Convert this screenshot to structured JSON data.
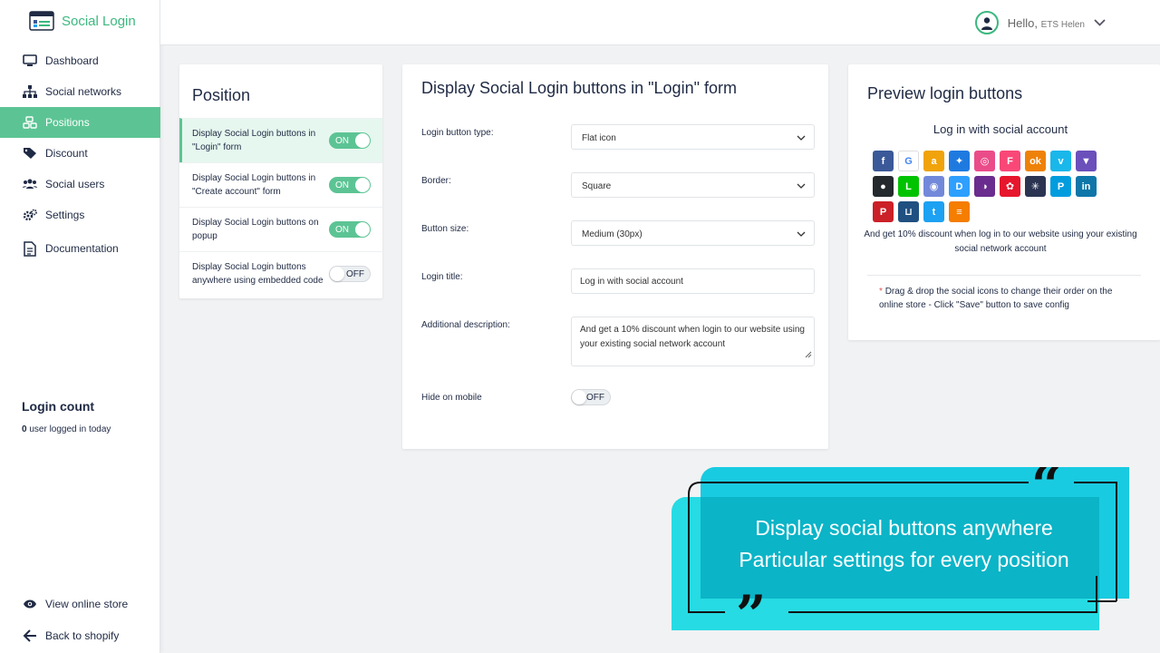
{
  "brand": {
    "name": "Social Login"
  },
  "sidebar": {
    "items": [
      {
        "label": "Dashboard",
        "icon": "monitor-icon"
      },
      {
        "label": "Social networks",
        "icon": "network-icon"
      },
      {
        "label": "Positions",
        "icon": "positions-icon"
      },
      {
        "label": "Discount",
        "icon": "tag-icon"
      },
      {
        "label": "Social users",
        "icon": "users-icon"
      },
      {
        "label": "Settings",
        "icon": "gears-icon"
      },
      {
        "label": "Documentation",
        "icon": "document-icon"
      }
    ],
    "login_count": {
      "title": "Login count",
      "count": "0",
      "suffix": "user logged in today"
    },
    "bottom": [
      {
        "label": "View online store",
        "icon": "eye-icon"
      },
      {
        "label": "Back to shopify",
        "icon": "arrow-left-icon"
      }
    ]
  },
  "header": {
    "hello": "Hello,",
    "user": "ETS Helen"
  },
  "position_card": {
    "title": "Position",
    "items": [
      {
        "label": "Display Social Login buttons in \"Login\" form",
        "toggle": "ON"
      },
      {
        "label": "Display Social Login buttons in \"Create account\" form",
        "toggle": "ON"
      },
      {
        "label": "Display Social Login buttons on popup",
        "toggle": "ON"
      },
      {
        "label": "Display Social Login buttons anywhere using embedded code",
        "toggle": "OFF"
      }
    ]
  },
  "form_card": {
    "title": "Display Social Login buttons in \"Login\" form",
    "login_button_type": {
      "label": "Login button type:",
      "value": "Flat icon"
    },
    "border": {
      "label": "Border:",
      "value": "Square"
    },
    "button_size": {
      "label": "Button size:",
      "value": "Medium (30px)"
    },
    "login_title": {
      "label": "Login title:",
      "value": "Log in with social account"
    },
    "additional_description": {
      "label": "Additional description:",
      "value": "And get a 10% discount when login to our website using your existing social network account"
    },
    "hide_on_mobile": {
      "label": "Hide on mobile",
      "toggle": "OFF"
    }
  },
  "preview_card": {
    "title": "Preview login buttons",
    "login_title": "Log in with social account",
    "icons": [
      {
        "name": "facebook-icon",
        "glyph": "f",
        "color": "#3b5998"
      },
      {
        "name": "google-icon",
        "glyph": "G",
        "color": "#ffffff"
      },
      {
        "name": "amazon-icon",
        "glyph": "a",
        "color": "#f0a30a"
      },
      {
        "name": "dropbox-icon",
        "glyph": "✦",
        "color": "#1f7ae0"
      },
      {
        "name": "dribbble-icon",
        "glyph": "◎",
        "color": "#ea4c89"
      },
      {
        "name": "foursquare-icon",
        "glyph": "F",
        "color": "#f94877"
      },
      {
        "name": "odnoklassniki-icon",
        "glyph": "ok",
        "color": "#ee8208"
      },
      {
        "name": "vimeo-icon",
        "glyph": "v",
        "color": "#1ab7ea"
      },
      {
        "name": "gitlab-icon",
        "glyph": "▼",
        "color": "#6b4fbb"
      },
      {
        "name": "github-icon",
        "glyph": "●",
        "color": "#24292e"
      },
      {
        "name": "line-icon",
        "glyph": "L",
        "color": "#00c300"
      },
      {
        "name": "discord-icon",
        "glyph": "◉",
        "color": "#7289da"
      },
      {
        "name": "disqus-icon",
        "glyph": "D",
        "color": "#2e9fff"
      },
      {
        "name": "instagram-icon",
        "glyph": "◑",
        "color": "#6a2c8e"
      },
      {
        "name": "weibo-icon",
        "glyph": "✿",
        "color": "#e6162d"
      },
      {
        "name": "yahoo-icon",
        "glyph": "✳",
        "color": "#2b3552"
      },
      {
        "name": "paypal-icon",
        "glyph": "P",
        "color": "#009cde"
      },
      {
        "name": "linkedin-icon",
        "glyph": "in",
        "color": "#0e76a8"
      },
      {
        "name": "pinterest-icon",
        "glyph": "P",
        "color": "#cb2027"
      },
      {
        "name": "bitbucket-icon",
        "glyph": "⊔",
        "color": "#205081"
      },
      {
        "name": "twitter-icon",
        "glyph": "t",
        "color": "#1da1f2"
      },
      {
        "name": "blogger-icon",
        "glyph": "≡",
        "color": "#f57d00"
      }
    ],
    "description": "And get 10% discount when log in to our website using your existing social network account",
    "note": "Drag & drop the social icons to change their order on the online store - Click \"Save\" button to save config"
  },
  "banner": {
    "line1": "Display social buttons anywhere",
    "line2": "Particular settings for every position"
  }
}
